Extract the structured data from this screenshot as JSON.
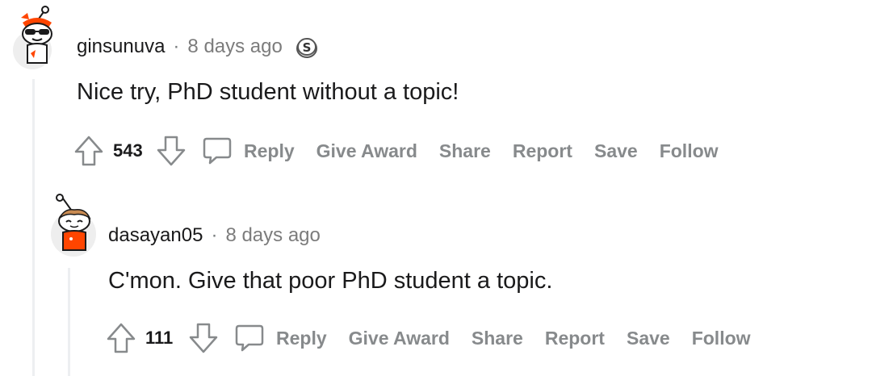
{
  "comments": [
    {
      "username": "ginsunuva",
      "separator": "·",
      "timestamp": "8 days ago",
      "badge_icon": "coin-s-icon",
      "body": "Nice try, PhD student without a topic!",
      "score": "543",
      "actions": {
        "reply": "Reply",
        "give_award": "Give Award",
        "share": "Share",
        "report": "Report",
        "save": "Save",
        "follow": "Follow"
      }
    },
    {
      "username": "dasayan05",
      "separator": "·",
      "timestamp": "8 days ago",
      "body": "C'mon. Give that poor PhD student a topic.",
      "score": "111",
      "actions": {
        "reply": "Reply",
        "give_award": "Give Award",
        "share": "Share",
        "report": "Report",
        "save": "Save",
        "follow": "Follow"
      }
    }
  ],
  "colors": {
    "action_text": "#878a8c",
    "thread_line": "#edeff1",
    "avatar_accent": "#ff4500"
  }
}
